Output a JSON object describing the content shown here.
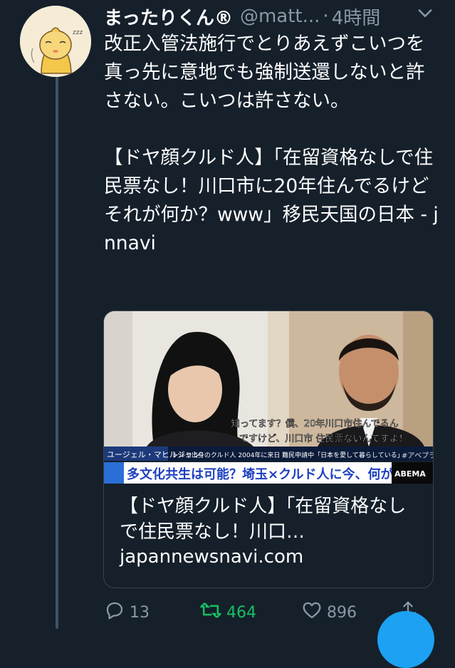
{
  "tweet": {
    "display_name": "まったりくん®",
    "handle": "@matt...",
    "separator": "·",
    "time": "4時間",
    "text": "改正入管法施行でとりあえずこいつを真っ先に意地でも強制送還しないと許さない。こいつは許さない。\n\n【ドヤ顔クルド人】「在留資格なしで住民票なし！川口市に20年住んでるけどそれが何か？www」移民天国の日本 - jnnavi"
  },
  "card": {
    "title": "【ドヤ顔クルド人】「在留資格なしで住民票なし！川口…",
    "domain": "japannewsnavi.com",
    "media": {
      "caption_line1": "知ってます？僕、20年川口市住んでるん",
      "caption_line2": "ですけど、川口市 住民票ないんですよ！",
      "name_tag": "ユージェル・マヒルジャン",
      "lower_third": "トルコ出身のクルド人 2004年に来日 難民申請中「日本を愛して暮らしている」",
      "watermark": "#アベプラ",
      "headline": "多文化共生は可能？埼玉×クルド人に今、何が",
      "brand": "ABEMA"
    }
  },
  "actions": {
    "reply_count": "13",
    "retweet_count": "464",
    "like_count": "896"
  },
  "colors": {
    "background": "#15202b",
    "secondary_text": "#8899a6",
    "retweet_green": "#17bf63",
    "accent": "#1da1f2"
  },
  "icons": [
    "avatar-illustration",
    "chevron-down-icon",
    "reply-icon",
    "retweet-icon",
    "like-icon",
    "share-icon"
  ]
}
